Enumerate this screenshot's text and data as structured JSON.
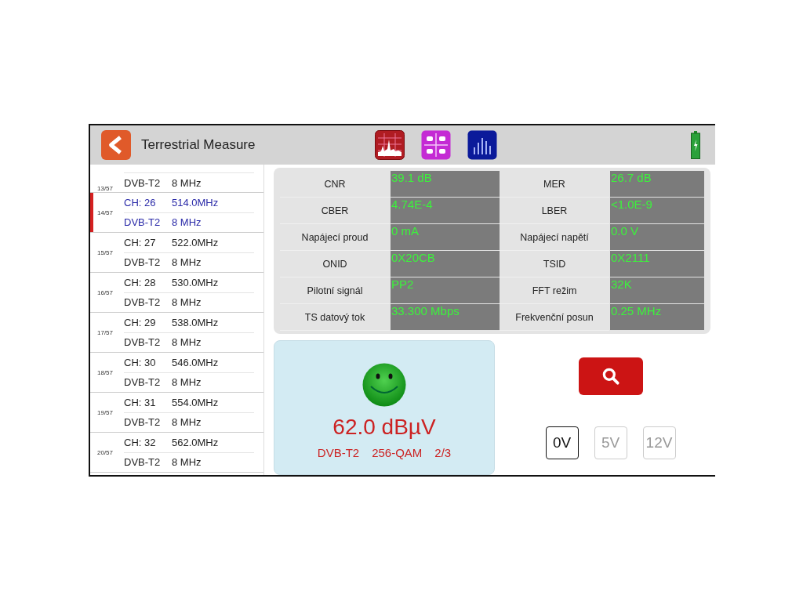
{
  "header": {
    "title": "Terrestrial Measure"
  },
  "channels": [
    {
      "index": "13/57",
      "system": "DVB-T2",
      "bandwidth": "8 MHz",
      "selected": false
    },
    {
      "index": "14/57",
      "ch": "CH: 26",
      "freq": "514.0MHz",
      "system": "DVB-T2",
      "bandwidth": "8 MHz",
      "selected": true
    },
    {
      "index": "15/57",
      "ch": "CH: 27",
      "freq": "522.0MHz",
      "system": "DVB-T2",
      "bandwidth": "8 MHz",
      "selected": false
    },
    {
      "index": "16/57",
      "ch": "CH: 28",
      "freq": "530.0MHz",
      "system": "DVB-T2",
      "bandwidth": "8 MHz",
      "selected": false
    },
    {
      "index": "17/57",
      "ch": "CH: 29",
      "freq": "538.0MHz",
      "system": "DVB-T2",
      "bandwidth": "8 MHz",
      "selected": false
    },
    {
      "index": "18/57",
      "ch": "CH: 30",
      "freq": "546.0MHz",
      "system": "DVB-T2",
      "bandwidth": "8 MHz",
      "selected": false
    },
    {
      "index": "19/57",
      "ch": "CH: 31",
      "freq": "554.0MHz",
      "system": "DVB-T2",
      "bandwidth": "8 MHz",
      "selected": false
    },
    {
      "index": "20/57",
      "ch": "CH: 32",
      "freq": "562.0MHz",
      "system": "DVB-T2",
      "bandwidth": "8 MHz",
      "selected": false
    }
  ],
  "measurements": [
    {
      "label": "CNR",
      "value": "39.1 dB"
    },
    {
      "label": "MER",
      "value": "26.7 dB"
    },
    {
      "label": "CBER",
      "value": "4.74E-4"
    },
    {
      "label": "LBER",
      "value": "<1.0E-9"
    },
    {
      "label": "Napájecí proud",
      "value": "0 mA"
    },
    {
      "label": "Napájecí napětí",
      "value": "0.0 V"
    },
    {
      "label": "ONID",
      "value": "0X20CB"
    },
    {
      "label": "TSID",
      "value": "0X2111"
    },
    {
      "label": "Pilotní signál",
      "value": "PP2"
    },
    {
      "label": "FFT režim",
      "value": "32K"
    },
    {
      "label": "TS datový tok",
      "value": "33.300 Mbps"
    },
    {
      "label": "Frekvenční posun",
      "value": "0.25 MHz"
    }
  ],
  "signal": {
    "level_text": "62.0 dBµV",
    "system": "DVB-T2",
    "modulation": "256-QAM",
    "code_rate": "2/3"
  },
  "voltage_buttons": [
    {
      "label": "0V",
      "selected": true
    },
    {
      "label": "5V",
      "selected": false
    },
    {
      "label": "12V",
      "selected": false
    }
  ]
}
